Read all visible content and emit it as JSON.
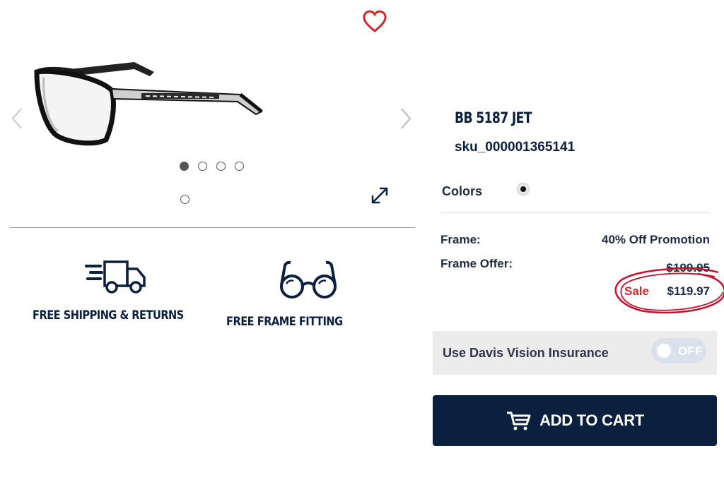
{
  "product": {
    "title": "BB 5187  JET",
    "sku": "sku_000001365141"
  },
  "gallery": {
    "image_alt": "black rectangular eyeglasses",
    "dots": [
      {
        "active": true
      },
      {
        "active": false
      },
      {
        "active": false
      },
      {
        "active": false
      }
    ],
    "icons": {
      "favorite": "heart-icon",
      "prev": "chevron-left-icon",
      "next": "chevron-right-icon",
      "expand": "expand-icon"
    }
  },
  "benefits": {
    "shipping_label": "FREE SHIPPING & RETURNS",
    "fitting_label": "FREE FRAME FITTING",
    "shipping_icon": "truck-icon",
    "fitting_icon": "glasses-icon"
  },
  "colors": {
    "label": "Colors",
    "selected_swatch": "#111111"
  },
  "pricing": {
    "frame_label": "Frame:",
    "promotion": "40% Off Promotion",
    "offer_label": "Frame Offer:",
    "original_price": "$199.95",
    "sale_word": "Sale",
    "sale_price": "$119.97"
  },
  "insurance": {
    "label": "Use Davis Vision Insurance",
    "toggle_state": "OFF"
  },
  "cart": {
    "button_label": "ADD TO CART",
    "icon": "cart-icon"
  },
  "theme": {
    "navy": "#0b1f3f",
    "sale_red": "#d0272a",
    "annotation_red": "#c8102e"
  }
}
